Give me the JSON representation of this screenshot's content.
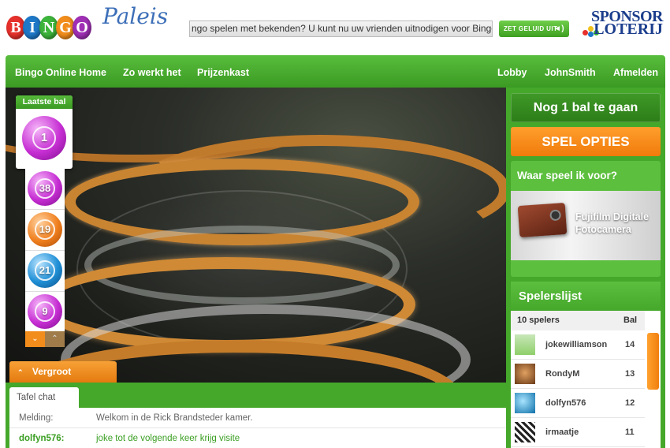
{
  "brand": {
    "logo_balls": [
      "B",
      "I",
      "N",
      "G",
      "O"
    ],
    "logo_ball_colors": [
      "#e6302b",
      "#1e78c8",
      "#3db43b",
      "#f28d1c",
      "#a02fb5"
    ],
    "logo_script": "Paleis",
    "sponsor_line1": "SPONSOR",
    "sponsor_line2": "LOTERIJ"
  },
  "header": {
    "ticker": "ngo spelen met bekenden? U kunt nu uw vrienden uitnodigen voor Bingo Online!",
    "sound_button": "ZET GELUID UIT",
    "sound_icon": "speaker-icon"
  },
  "nav": {
    "left": [
      "Bingo Online Home",
      "Zo werkt het",
      "Prijzenkast"
    ],
    "right": [
      "Lobby",
      "JohnSmith",
      "Afmelden"
    ]
  },
  "game": {
    "last_ball_label": "Laatste bal",
    "last_ball": {
      "number": "1",
      "color": "purple"
    },
    "history": [
      {
        "number": "38",
        "color": "purple"
      },
      {
        "number": "19",
        "color": "orange"
      },
      {
        "number": "21",
        "color": "blue"
      },
      {
        "number": "9",
        "color": "purple"
      }
    ],
    "scroll_down_icon": "chevron-down-icon",
    "scroll_up_icon": "chevron-up-icon",
    "chat_toggle": "Vergroot chatroom",
    "chat_toggle_icon": "chevron-up-icon"
  },
  "chat": {
    "tab": "Tafel chat",
    "rows": [
      {
        "who": "Melding:",
        "msg": "Welkom in de Rick Brandsteder kamer.",
        "color": "#666666"
      },
      {
        "who": "dolfyn576:",
        "msg": "joke tot de volgende keer krijg visite",
        "color": "#3a9e22"
      }
    ]
  },
  "sidebar": {
    "status": "Nog 1 bal te gaan",
    "options_button": "SPEL OPTIES",
    "prize_title": "Waar speel ik voor?",
    "prize_text": "Fujifilm Digitale Fotocamera",
    "players_title": "Spelerslijst",
    "players_count": "10 spelers",
    "players_col": "Bal",
    "players": [
      {
        "name": "jokewilliamson",
        "bal": "14",
        "avatar": "generic-avatar-icon"
      },
      {
        "name": "RondyM",
        "bal": "13",
        "avatar": "cat-avatar-icon"
      },
      {
        "name": "dolfyn576",
        "bal": "12",
        "avatar": "dolphin-avatar-icon"
      },
      {
        "name": "irmaatje",
        "bal": "11",
        "avatar": "pattern-avatar-icon"
      }
    ]
  },
  "colors": {
    "green": "#45a82b",
    "orange": "#f28d1c"
  }
}
